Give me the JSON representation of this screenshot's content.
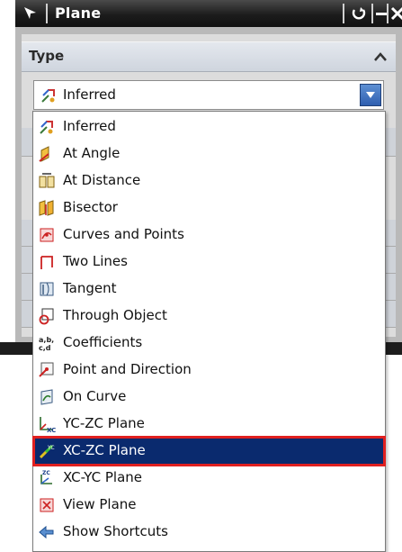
{
  "window": {
    "title": "Plane",
    "buttons": [
      "reset",
      "minimize",
      "close"
    ]
  },
  "section": {
    "title": "Type"
  },
  "combo": {
    "selected": "Inferred",
    "selected_icon": "inferred-icon"
  },
  "dropdown": {
    "selected_index": 12,
    "items": [
      {
        "label": "Inferred",
        "icon": "inferred-icon"
      },
      {
        "label": "At Angle",
        "icon": "at-angle-icon"
      },
      {
        "label": "At Distance",
        "icon": "at-distance-icon"
      },
      {
        "label": "Bisector",
        "icon": "bisector-icon"
      },
      {
        "label": "Curves and Points",
        "icon": "curves-and-points-icon"
      },
      {
        "label": "Two Lines",
        "icon": "two-lines-icon"
      },
      {
        "label": "Tangent",
        "icon": "tangent-icon"
      },
      {
        "label": "Through Object",
        "icon": "through-object-icon"
      },
      {
        "label": "Coefficients",
        "icon": "coefficients-icon"
      },
      {
        "label": "Point and Direction",
        "icon": "point-and-direction-icon"
      },
      {
        "label": "On Curve",
        "icon": "on-curve-icon"
      },
      {
        "label": "YC-ZC Plane",
        "icon": "yc-zc-plane-icon"
      },
      {
        "label": "XC-ZC Plane",
        "icon": "xc-zc-plane-icon"
      },
      {
        "label": "XC-YC Plane",
        "icon": "xc-yc-plane-icon"
      },
      {
        "label": "View Plane",
        "icon": "view-plane-icon"
      },
      {
        "label": "Show Shortcuts",
        "icon": "show-shortcuts-icon"
      }
    ]
  },
  "colors": {
    "selection_bg": "#0a2a6e",
    "selection_outline": "#e02020",
    "title_bar": "#1c1c1c"
  }
}
